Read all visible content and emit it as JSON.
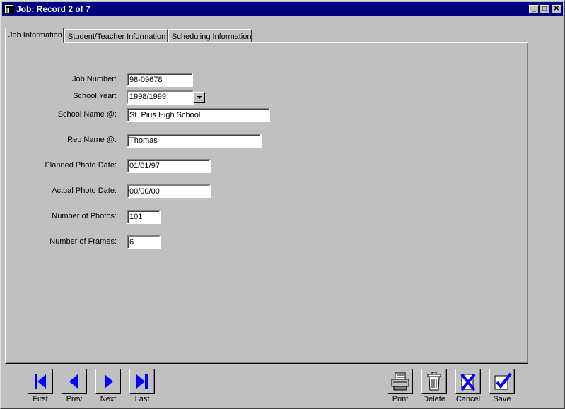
{
  "window": {
    "title": "Job: Record 2 of 7",
    "minimize_glyph": "_",
    "maximize_glyph": "□",
    "close_glyph": "✕"
  },
  "tabs": [
    {
      "label": "Job Information"
    },
    {
      "label": "Student/Teacher Information"
    },
    {
      "label": "Scheduling Information"
    }
  ],
  "form": {
    "job_number": {
      "label": "Job Number:",
      "value": "98-09678"
    },
    "school_year": {
      "label": "School Year:",
      "value": "1998/1999"
    },
    "school_name": {
      "label": "School Name @:",
      "value": "St. Pius High School"
    },
    "rep_name": {
      "label": "Rep Name @:",
      "value": "Thomas"
    },
    "planned_photo_date": {
      "label": "Planned Photo Date:",
      "value": "01/01/97"
    },
    "actual_photo_date": {
      "label": "Actual Photo Date:",
      "value": "00/00/00"
    },
    "number_of_photos": {
      "label": "Number of Photos:",
      "value": "101"
    },
    "number_of_frames": {
      "label": "Number of Frames:",
      "value": "6"
    }
  },
  "nav": {
    "first": "First",
    "prev": "Prev",
    "next": "Next",
    "last": "Last"
  },
  "actions": {
    "print": "Print",
    "delete": "Delete",
    "cancel": "Cancel",
    "save": "Save"
  },
  "colors": {
    "titlebar": "#000080",
    "face": "#c0c0c0",
    "accent_blue": "#0000ff"
  }
}
